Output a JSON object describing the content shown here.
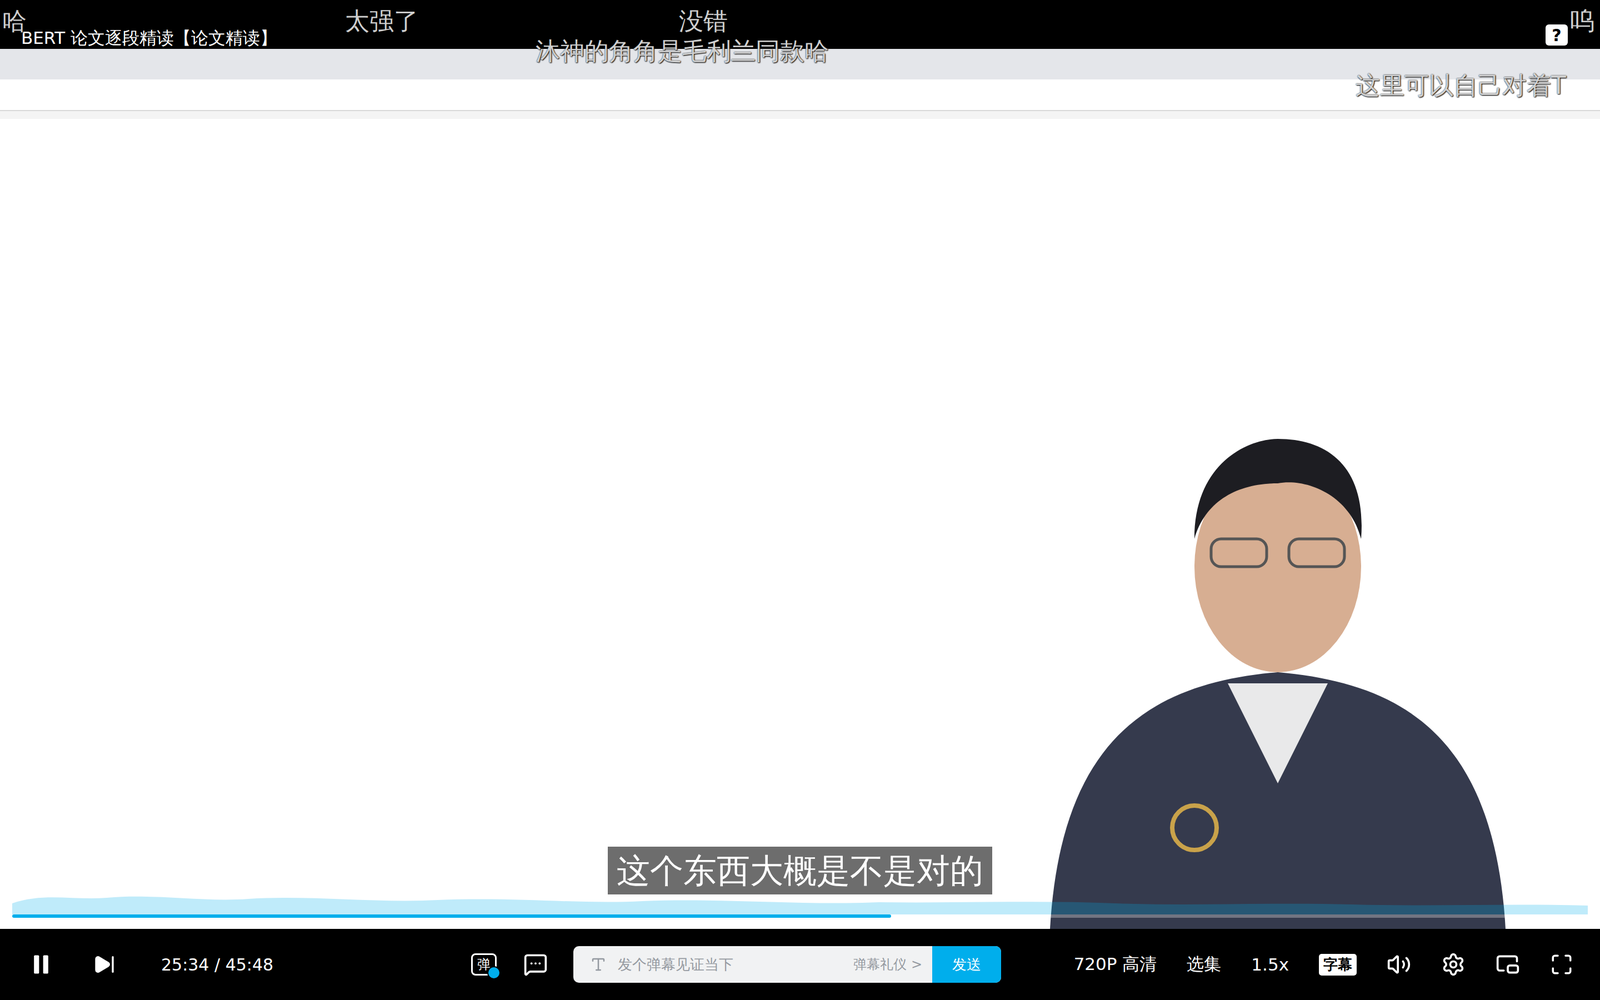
{
  "video": {
    "title": "BERT 论文逐段精读【论文精读】",
    "subtitle": "这个东西大概是不是对的",
    "progress": 0.558,
    "help": "?"
  },
  "danmaku": [
    {
      "text": "哈"
    },
    {
      "text": "太强了"
    },
    {
      "text": "没错"
    },
    {
      "text": "呜"
    },
    {
      "text": "沐神的角角是毛利兰同款哈"
    },
    {
      "text": "这里可以自己对着T"
    }
  ],
  "controls": {
    "playing": true,
    "time": "25:34 / 45:48",
    "danmaku_toggle": "弹",
    "danmaku_on": true,
    "input_placeholder": "发个弹幕见证当下",
    "etiquette": "弹幕礼仪 >",
    "send": "发送",
    "quality": "720P 高清",
    "episodes": "选集",
    "speed": "1.5x",
    "captions": "字幕"
  }
}
